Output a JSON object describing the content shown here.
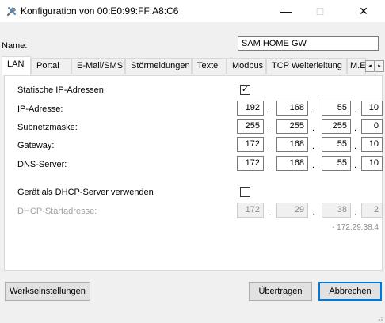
{
  "window": {
    "title": "Konfiguration von 00:E0:99:FF:A8:C6",
    "minimize": "—",
    "maximize": "□",
    "close": "✕"
  },
  "name_field": {
    "label": "Name:",
    "value": "SAM HOME GW"
  },
  "tabs": [
    "LAN",
    "Portal",
    "E-Mail/SMS",
    "Störmeldungen",
    "Texte",
    "Modbus",
    "TCP Weiterleitung",
    "M.E"
  ],
  "tab_scroll": {
    "left": "◂",
    "right": "▸"
  },
  "lan": {
    "static_ip": {
      "label": "Statische IP-Adressen",
      "checked": "✓"
    },
    "ip_address": {
      "label": "IP-Adresse:",
      "octets": [
        "192",
        "168",
        "55",
        "10"
      ]
    },
    "subnet_mask": {
      "label": "Subnetzmaske:",
      "octets": [
        "255",
        "255",
        "255",
        "0"
      ]
    },
    "gateway": {
      "label": "Gateway:",
      "octets": [
        "172",
        "168",
        "55",
        "10"
      ]
    },
    "dns_server": {
      "label": "DNS-Server:",
      "octets": [
        "172",
        "168",
        "55",
        "10"
      ]
    },
    "dhcp_server": {
      "label": "Gerät als DHCP-Server verwenden",
      "checked": ""
    },
    "dhcp_start": {
      "label": "DHCP-Startadresse:",
      "octets": [
        "172",
        "29",
        "38",
        "2"
      ],
      "range_end": "- 172.29.38.4"
    },
    "dot": "."
  },
  "buttons": {
    "factory_reset": "Werkseinstellungen",
    "transfer": "Übertragen",
    "cancel": "Abbrechen"
  }
}
